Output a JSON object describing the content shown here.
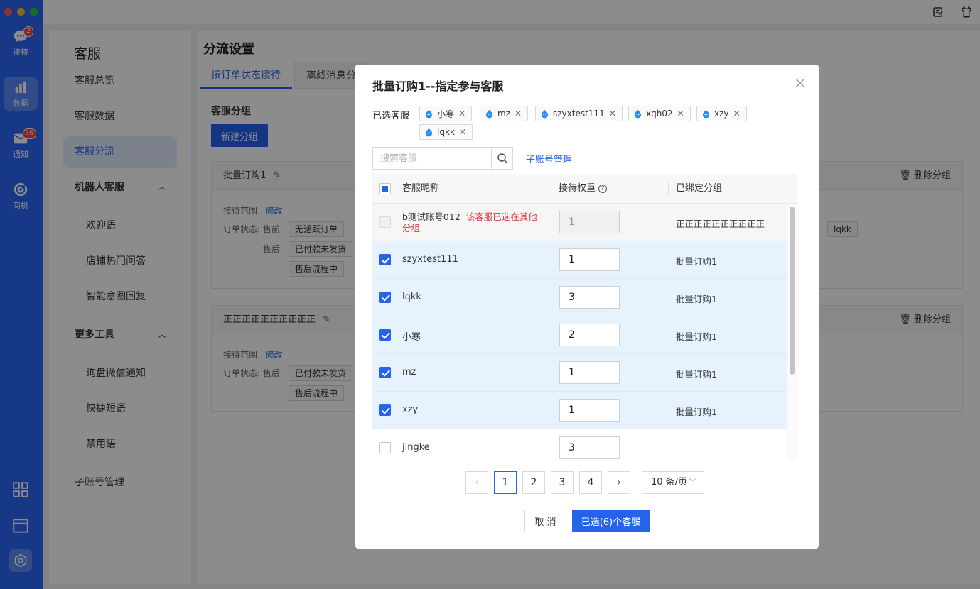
{
  "rail": {
    "items": [
      {
        "label": "接待",
        "badge": "2",
        "icon": "chat-icon"
      },
      {
        "label": "数据",
        "icon": "bar-chart-icon",
        "active": true
      },
      {
        "label": "通知",
        "badge": "36",
        "icon": "mail-icon"
      },
      {
        "label": "商机",
        "icon": "target-icon"
      }
    ],
    "colors": {
      "background": "#2b66f6",
      "badge": "#f43f3f"
    }
  },
  "sidebar": {
    "title": "客服",
    "items": [
      {
        "label": "客服总览"
      },
      {
        "label": "客服数据"
      },
      {
        "label": "客服分流",
        "active": true
      },
      {
        "label": "机器人客服",
        "group": true
      },
      {
        "label": "欢迎语"
      },
      {
        "label": "店铺热门问答"
      },
      {
        "label": "智能意图回复"
      },
      {
        "label": "更多工具",
        "group": true
      },
      {
        "label": "询盘微信通知"
      },
      {
        "label": "快捷短语"
      },
      {
        "label": "禁用语"
      },
      {
        "label": "子账号管理"
      }
    ]
  },
  "main": {
    "title": "分流设置",
    "tabs": [
      "按订单状态接待",
      "离线消息分"
    ],
    "section": "客服分组",
    "new_group": "新建分组",
    "delete_group": "删除分组",
    "scope_label": "接待范围",
    "edit": "修改",
    "order_status": "订单状态:",
    "presale": "售前",
    "aftersale": "售后",
    "groups": [
      {
        "name": "批量订购1",
        "chips": [
          "无活跃订单",
          "已付款未发货",
          "售后流程中"
        ],
        "extra_chip": "lqkk"
      },
      {
        "name": "正正正正正正正正正正",
        "chips": [
          "已付款未发货",
          "售后流程中"
        ]
      }
    ]
  },
  "modal": {
    "title": "批量订购1--指定参与客服",
    "selected_label": "已选客服",
    "selected_tags": [
      "小寒",
      "mz",
      "szyxtest111",
      "xqh02",
      "xzy",
      "lqkk"
    ],
    "search_placeholder": "搜索客服",
    "sub_account_link": "子账号管理",
    "columns": {
      "name": "客服昵称",
      "weight": "接待权重",
      "group": "已绑定分组"
    },
    "rows": [
      {
        "name": "b测试账号012",
        "warning": "该客服已选在其他分组",
        "weight": "1",
        "group": "正正正正正正正正正正",
        "checked": false,
        "disabled": true
      },
      {
        "name": "szyxtest111",
        "weight": "1",
        "group": "批量订购1",
        "checked": true
      },
      {
        "name": "lqkk",
        "weight": "3",
        "group": "批量订购1",
        "checked": true
      },
      {
        "name": "小寒",
        "weight": "2",
        "group": "批量订购1",
        "checked": true
      },
      {
        "name": "mz",
        "weight": "1",
        "group": "批量订购1",
        "checked": true
      },
      {
        "name": "xzy",
        "weight": "1",
        "group": "批量订购1",
        "checked": true
      },
      {
        "name": "jingke",
        "weight": "3",
        "group": "",
        "checked": false
      }
    ],
    "pagination": {
      "pages": [
        "1",
        "2",
        "3",
        "4"
      ],
      "current": "1",
      "page_size": "10 条/页"
    },
    "cancel": "取 消",
    "confirm": "已选(6)个客服",
    "accent": "#2563eb",
    "warning_color": "#d9363e"
  }
}
